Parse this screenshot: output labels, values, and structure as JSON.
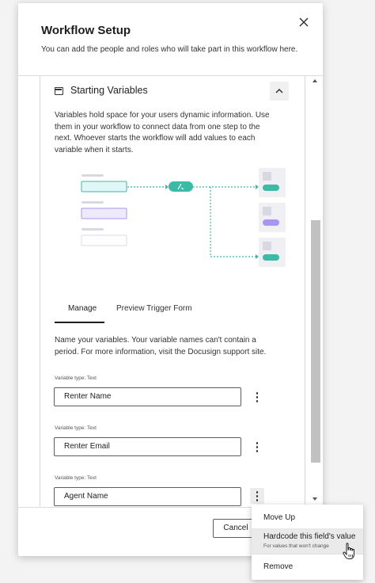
{
  "modal": {
    "title": "Workflow Setup",
    "subtitle": "You can add the people and roles who will take part in this workflow here."
  },
  "section": {
    "title": "Starting Variables",
    "description": "Variables hold space for your users dynamic information. Use them in your workflow to connect data from one step to the next. Whoever starts the workflow will add values to each variable when it starts."
  },
  "tabs": [
    {
      "label": "Manage",
      "active": true
    },
    {
      "label": "Preview Trigger Form",
      "active": false
    }
  ],
  "help_text": "Name your variables. Your variable names can't contain a period. For more information, visit the Docusign support site.",
  "variables": [
    {
      "type_label": "Variable type: Text",
      "value": "Renter Name"
    },
    {
      "type_label": "Variable type: Text",
      "value": "Renter Email"
    },
    {
      "type_label": "Variable type: Text",
      "value": "Agent Name"
    }
  ],
  "footer": {
    "cancel_label": "Cancel"
  },
  "menu": {
    "items": [
      {
        "label": "Move Up"
      },
      {
        "label": "Hardcode this field's value",
        "sublabel": "For values that won't change"
      },
      {
        "label": "Remove"
      }
    ]
  },
  "colors": {
    "teal": "#3dbaa5",
    "teal_light": "#dff7f6",
    "purple": "#a996f0",
    "purple_light": "#eeeafa",
    "placeholder_bar": "#d8d8e3",
    "card_bg": "#efeff4"
  },
  "icons": {
    "close": "close-icon",
    "section": "card-icon",
    "collapse": "chevron-up-icon",
    "kebab": "more-vertical-icon",
    "cursor": "hand-pointer-icon"
  }
}
